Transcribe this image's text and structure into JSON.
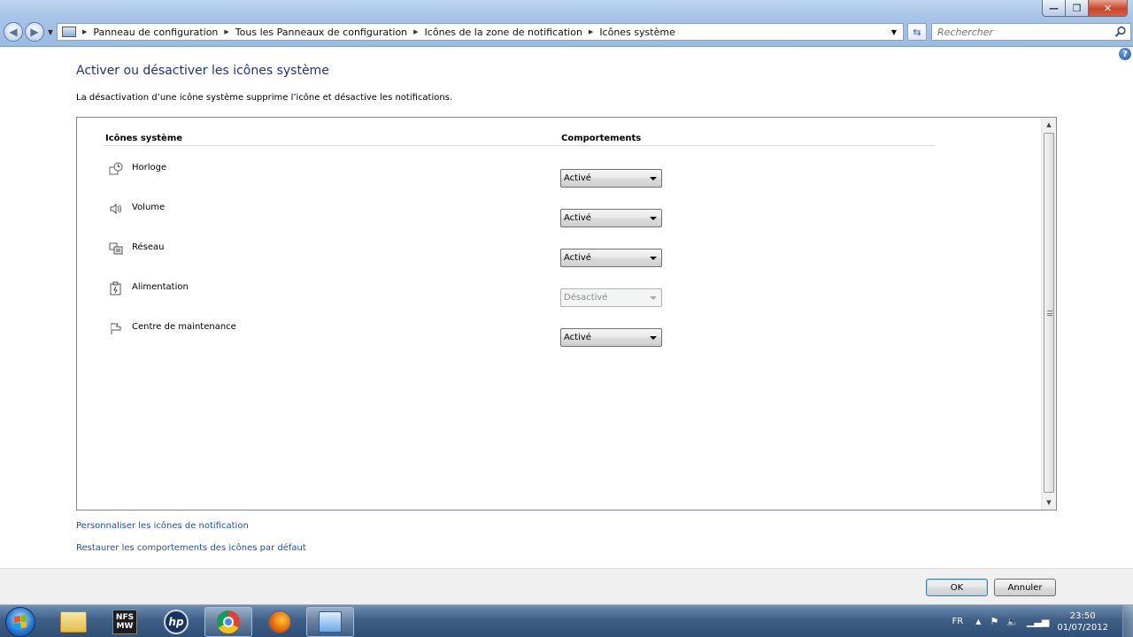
{
  "window": {
    "minimize": "—",
    "maximize": "❐",
    "close": "✕"
  },
  "address": {
    "breadcrumbs": [
      "Panneau de configuration",
      "Tous les Panneaux de configuration",
      "Icônes de la zone de notification",
      "Icônes système"
    ]
  },
  "search": {
    "placeholder": "Rechercher"
  },
  "help": "?",
  "page": {
    "title": "Activer ou désactiver les icônes système",
    "description": "La désactivation d’une icône système supprime l’icône et désactive les notifications."
  },
  "table": {
    "col_icons": "Icônes système",
    "col_behaviors": "Comportements",
    "rows": [
      {
        "icon": "clock-icon",
        "label": "Horloge",
        "value": "Activé",
        "disabled": false
      },
      {
        "icon": "volume-icon",
        "label": "Volume",
        "value": "Activé",
        "disabled": false
      },
      {
        "icon": "network-icon",
        "label": "Réseau",
        "value": "Activé",
        "disabled": false
      },
      {
        "icon": "power-icon",
        "label": "Alimentation",
        "value": "Désactivé",
        "disabled": true
      },
      {
        "icon": "flag-icon",
        "label": "Centre de maintenance",
        "value": "Activé",
        "disabled": false
      }
    ]
  },
  "links": {
    "customize": "Personnaliser les icônes de notification",
    "restore": "Restaurer les comportements des icônes par défaut"
  },
  "buttons": {
    "ok": "OK",
    "cancel": "Annuler"
  },
  "taskbar": {
    "mw_top": "NFS",
    "mw_bottom": "MW",
    "hp": "hp",
    "language": "FR",
    "time": "23:50",
    "date": "01/07/2012"
  },
  "colors": {
    "title_blue": "#1e3287",
    "link_blue": "#1f4f9d",
    "taskbar": "#2f4f77"
  }
}
